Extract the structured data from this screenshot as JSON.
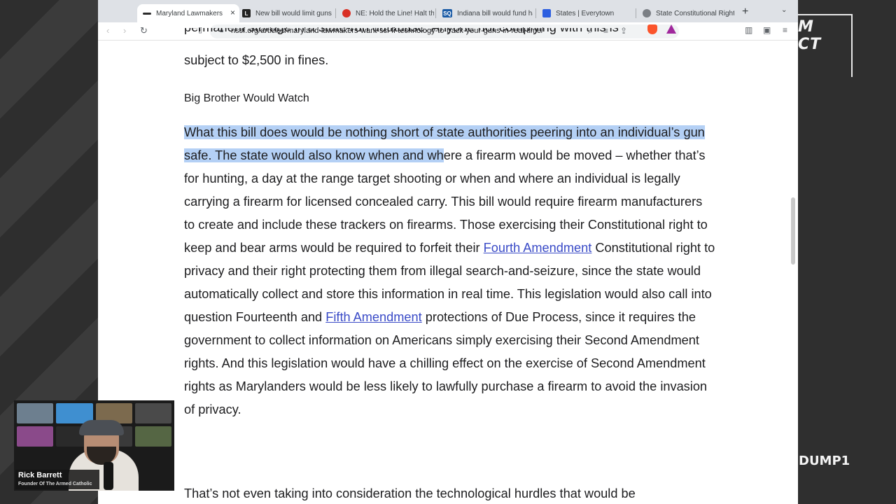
{
  "stream": {
    "logo_text": "M CT",
    "side_tag": "DUMP1",
    "webcam": {
      "name": "Rick Barrett",
      "subtitle": "Founder Of The Armed Catholic"
    }
  },
  "browser": {
    "tabs": [
      {
        "label": "Maryland Lawmakers",
        "icon": "nssf-icon",
        "active": true
      },
      {
        "label": "New bill would limit guns",
        "icon": "letter-l-icon",
        "active": false
      },
      {
        "label": "NE: Hold the Line! Halt th",
        "icon": "red-circle-icon",
        "active": false
      },
      {
        "label": "Indiana bill would fund ha",
        "icon": "sq-icon",
        "active": false
      },
      {
        "label": "States | Everytown",
        "icon": "everytown-icon",
        "active": false
      },
      {
        "label": "State Constitutional Right",
        "icon": "globe-icon",
        "active": false
      }
    ],
    "tab_close": "×",
    "new_tab": "+",
    "tab_menu": "⌄",
    "url": "nssf.org/articles/maryland-lawmakers-want-sci-fi-technology-to-track-your-guns-in-real-time/",
    "brave_color": "#fb542b",
    "bat_color": "#a0289c"
  },
  "article": {
    "cut_line": "permanent storage in a state-run database. Anyone not complying with this is",
    "intro_end": "subject to $2,500 in fines.",
    "heading": "Big Brother Would Watch",
    "para_highlight": "What this bill does would be nothing short of state authorities peering into an individual’s gun safe. The state would also know when and wh",
    "para_a": "ere a firearm would be moved – whether that’s for hunting, a day at the range target shooting or when and where an individual is legally carrying a firearm for licensed concealed carry. This bill would require firearm manufacturers to create and include these trackers on firearms. Those exercising their Constitutional right to keep and bear arms would be required to forfeit their ",
    "link_fourth": "Fourth Amendment",
    "para_b": " Constitutional right to privacy and their right protecting them from illegal search-and-seizure, since the state would automatically collect and store this information in real time. This legislation would also call into question Fourteenth and ",
    "link_fifth": "Fifth Amendment",
    "para_c": " protections of Due Process, since it requires the government to collect information on Americans simply exercising their Second Amendment rights. And this legislation would have a chilling effect on the exercise of Second Amendment rights as Marylanders would be less likely to lawfully purchase a firearm to avoid the invasion of privacy.",
    "next_para": "That’s not even taking into consideration the technological hurdles that would be",
    "highlight_color": "#b4d0f5",
    "link_color": "#3a4bc7"
  }
}
